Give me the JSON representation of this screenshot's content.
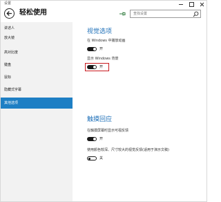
{
  "window": {
    "title": "设置"
  },
  "header": {
    "title": "轻松使用",
    "search_placeholder": "查找设置"
  },
  "sidebar": {
    "items": [
      {
        "label": "讲述人"
      },
      {
        "label": "放大镜"
      },
      {
        "label": "高对比度"
      },
      {
        "label": "键盘"
      },
      {
        "label": "鼠标"
      },
      {
        "label": "隐藏式字幕"
      },
      {
        "label": "其他选项",
        "active": true
      }
    ]
  },
  "visual": {
    "title": "视觉选项",
    "animation_label": "在 Windows 中播放动画",
    "animation_state": "开",
    "background_label": "显示 Windows 背景",
    "background_state": "开"
  },
  "touch": {
    "title": "触摸回应",
    "feedback_label": "在触摸屏幕时显示可视反馈",
    "feedback_state": "开",
    "dark_label": "使用颜色较深、尺寸较大的视觉反馈(适用于演示文稿)",
    "dark_state": "关"
  },
  "colors": {
    "accent": "#1e7fc4",
    "section_title": "#1d6fb8",
    "highlight": "#c8191e"
  }
}
